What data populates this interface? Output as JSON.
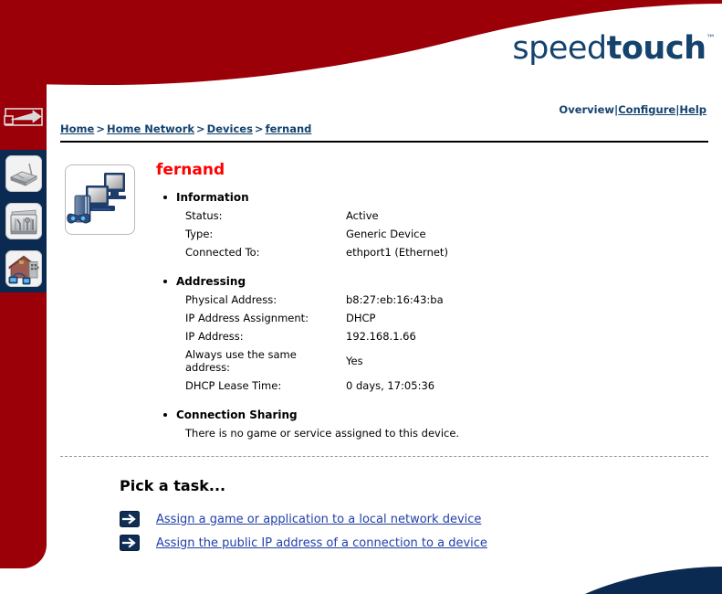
{
  "brand": {
    "name_light": "speed",
    "name_heavy": "touch",
    "trademark": "™"
  },
  "toplinks": {
    "overview": "Overview",
    "separator1": "|",
    "configure": "Configure",
    "separator2": "|",
    "help": "Help"
  },
  "breadcrumb": {
    "items": [
      {
        "label": "Home"
      },
      {
        "label": "Home Network"
      },
      {
        "label": "Devices"
      },
      {
        "label": "fernand"
      }
    ],
    "separator": ">"
  },
  "sidebar": {
    "items": [
      {
        "name": "pointer-arrow",
        "icon": "arrow-right-icon"
      },
      {
        "name": "broadband-connection",
        "icon": "modem-icon"
      },
      {
        "name": "toolbox",
        "icon": "toolbox-icon"
      },
      {
        "name": "home-network",
        "icon": "house-network-icon"
      }
    ]
  },
  "device": {
    "title": "fernand",
    "icon": "computers-gameconsole-icon",
    "sections": [
      {
        "heading": "Information",
        "rows": [
          {
            "key": "Status:",
            "value": "Active"
          },
          {
            "key": "Type:",
            "value": "Generic Device"
          },
          {
            "key": "Connected To:",
            "value": "ethport1 (Ethernet)"
          }
        ]
      },
      {
        "heading": "Addressing",
        "rows": [
          {
            "key": "Physical Address:",
            "value": "b8:27:eb:16:43:ba"
          },
          {
            "key": "IP Address Assignment:",
            "value": "DHCP"
          },
          {
            "key": "IP Address:",
            "value": "192.168.1.66"
          },
          {
            "key": "Always use the same address:",
            "value": "Yes"
          },
          {
            "key": "DHCP Lease Time:",
            "value": "0 days, 17:05:36"
          }
        ]
      },
      {
        "heading": "Connection Sharing",
        "note": "There is no game or service assigned to this device."
      }
    ]
  },
  "tasks": {
    "title": "Pick a task...",
    "items": [
      {
        "label": "Assign a game or application to a local network device",
        "icon": "arrow-right-box-icon"
      },
      {
        "label": "Assign the public IP address of a connection to a device",
        "icon": "arrow-right-box-icon"
      }
    ]
  },
  "colors": {
    "brand_red": "#9B0008",
    "brand_navy": "#0B2A52",
    "logo_blue": "#14436E",
    "link_blue": "#1F3FA8",
    "title_red": "#FF0000"
  }
}
